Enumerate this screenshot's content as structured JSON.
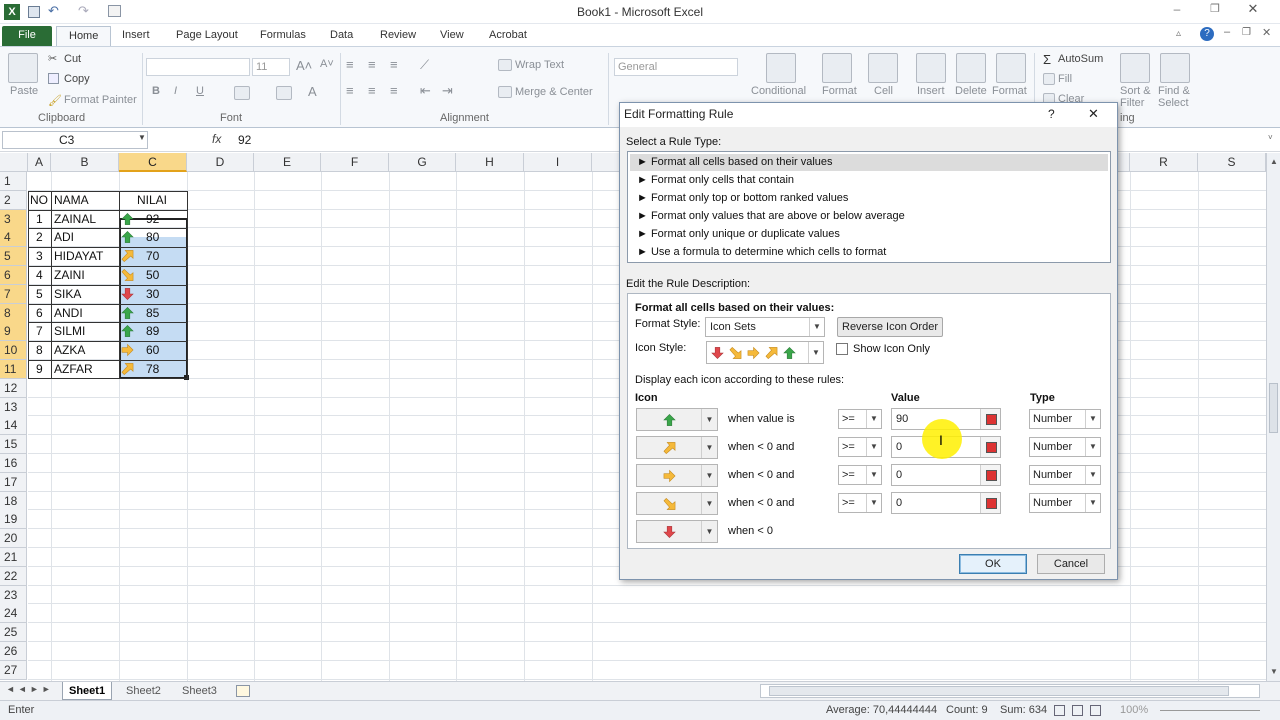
{
  "window": {
    "title": "Book1  -  Microsoft Excel"
  },
  "ribbon_tabs": [
    "File",
    "Home",
    "Insert",
    "Page Layout",
    "Formulas",
    "Data",
    "Review",
    "View",
    "Acrobat"
  ],
  "ribbon": {
    "clipboard": {
      "paste": "Paste",
      "cut": "Cut",
      "copy": "Copy",
      "format_painter": "Format Painter",
      "label": "Clipboard"
    },
    "font": {
      "size": "11",
      "bold": "B",
      "italic": "I",
      "underline": "U",
      "label": "Font"
    },
    "alignment": {
      "wrap_text": "Wrap Text",
      "merge_center": "Merge & Center",
      "label": "Alignment"
    },
    "number": {
      "format": "General"
    },
    "styles": {
      "conditional": "Conditional",
      "format": "Format",
      "cell": "Cell"
    },
    "cells": {
      "insert": "Insert",
      "delete": "Delete",
      "format": "Format"
    },
    "editing": {
      "autosum": "AutoSum",
      "fill": "Fill",
      "clear": "Clear",
      "sort": "Sort &",
      "filter": "Filter",
      "find": "Find &",
      "select": "Select",
      "label_partial": "ing"
    }
  },
  "formula_bar": {
    "name_box": "C3",
    "fx": "fx",
    "value": "92"
  },
  "columns": [
    "A",
    "B",
    "C",
    "D",
    "E",
    "F",
    "G",
    "H",
    "I",
    "R",
    "S"
  ],
  "rows": [
    "1",
    "2",
    "3",
    "4",
    "5",
    "6",
    "7",
    "8",
    "9",
    "10",
    "11",
    "12",
    "13",
    "14",
    "15",
    "16",
    "17",
    "18",
    "19",
    "20",
    "21",
    "22",
    "23",
    "24",
    "25",
    "26",
    "27"
  ],
  "table": {
    "headers": {
      "no": "NO",
      "nama": "NAMA",
      "nilai": "NILAI"
    },
    "data": [
      {
        "no": "1",
        "nama": "ZAINAL",
        "nilai": "92",
        "icon": "up"
      },
      {
        "no": "2",
        "nama": "ADI",
        "nilai": "80",
        "icon": "up"
      },
      {
        "no": "3",
        "nama": "HIDAYAT",
        "nilai": "70",
        "icon": "up-right"
      },
      {
        "no": "4",
        "nama": "ZAINI",
        "nilai": "50",
        "icon": "down-right"
      },
      {
        "no": "5",
        "nama": "SIKA",
        "nilai": "30",
        "icon": "down"
      },
      {
        "no": "6",
        "nama": "ANDI",
        "nilai": "85",
        "icon": "up"
      },
      {
        "no": "7",
        "nama": "SILMI",
        "nilai": "89",
        "icon": "up"
      },
      {
        "no": "8",
        "nama": "AZKA",
        "nilai": "60",
        "icon": "right"
      },
      {
        "no": "9",
        "nama": "AZFAR",
        "nilai": "78",
        "icon": "up-right"
      }
    ]
  },
  "sheets": [
    "Sheet1",
    "Sheet2",
    "Sheet3"
  ],
  "status": {
    "mode": "Enter",
    "average": "Average: 70,44444444",
    "count": "Count: 9",
    "sum": "Sum: 634",
    "zoom": "100%"
  },
  "dialog": {
    "title": "Edit Formatting Rule",
    "help": "?",
    "close": "✕",
    "select_rule_type_label": "Select a Rule Type:",
    "rule_types": [
      "► Format all cells based on their values",
      "► Format only cells that contain",
      "► Format only top or bottom ranked values",
      "► Format only values that are above or below average",
      "► Format only unique or duplicate values",
      "► Use a formula to determine which cells to format"
    ],
    "edit_desc_label": "Edit the Rule Description:",
    "desc_heading": "Format all cells based on their values:",
    "format_style_label": "Format Style:",
    "format_style_value": "Icon Sets",
    "reverse_btn": "Reverse Icon Order",
    "icon_style_label": "Icon Style:",
    "show_icon_only": "Show Icon Only",
    "display_rules_label": "Display each icon according to these rules:",
    "col_icon": "Icon",
    "col_value": "Value",
    "col_type": "Type",
    "rules": [
      {
        "icon": "up",
        "text": "when value is",
        "op": ">=",
        "value": "90",
        "type": "Number"
      },
      {
        "icon": "up-right",
        "text": "when < 0 and",
        "op": ">=",
        "value": "0",
        "type": "Number"
      },
      {
        "icon": "right",
        "text": "when < 0 and",
        "op": ">=",
        "value": "0",
        "type": "Number"
      },
      {
        "icon": "down-right",
        "text": "when < 0 and",
        "op": ">=",
        "value": "0",
        "type": "Number"
      },
      {
        "icon": "down",
        "text": "when < 0"
      }
    ],
    "ok": "OK",
    "cancel": "Cancel"
  },
  "colors": {
    "excel_green": "#2a6c35",
    "selection": "#c5dcf3",
    "header_sel": "#f9d88a",
    "arrow_green": "#3aa64a",
    "arrow_yellow": "#f5b93a",
    "arrow_red": "#e0474c"
  }
}
